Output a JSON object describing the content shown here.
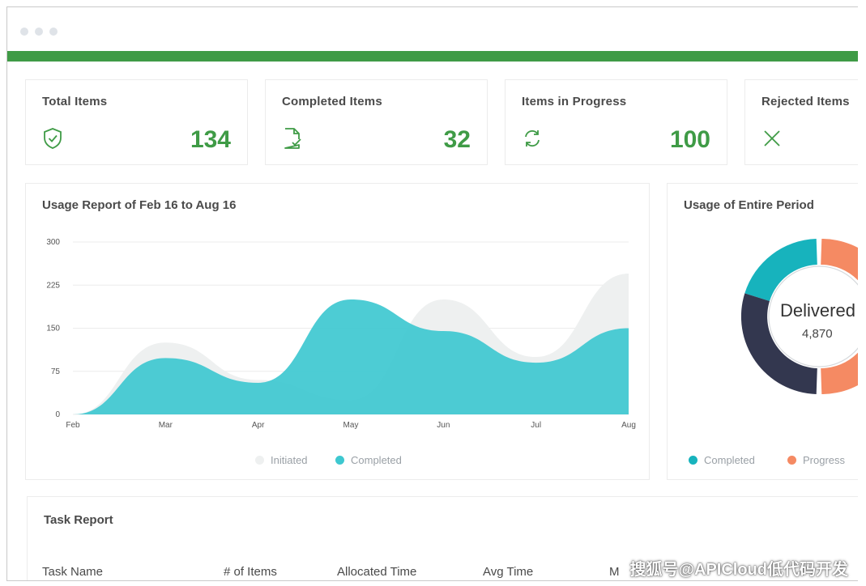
{
  "stats": [
    {
      "label": "Total Items",
      "value": "134",
      "icon": "shield-check-icon"
    },
    {
      "label": "Completed Items",
      "value": "32",
      "icon": "document-check-icon"
    },
    {
      "label": "Items in Progress",
      "value": "100",
      "icon": "refresh-icon"
    },
    {
      "label": "Rejected Items",
      "value": "",
      "icon": "close-icon"
    }
  ],
  "usage_report": {
    "title": "Usage Report of Feb 16 to Aug 16"
  },
  "usage_period": {
    "title": "Usage of Entire Period",
    "center_label": "Delivered",
    "center_value": "4,870"
  },
  "task_report": {
    "title": "Task Report",
    "columns": [
      "Task Name",
      "# of Items",
      "Allocated Time",
      "Avg Time",
      "M"
    ]
  },
  "watermark": "搜狐号@APICloud低代码开发",
  "colors": {
    "accent": "#3f9b46",
    "completed": "#3ec8d0",
    "initiated": "#eef0f0",
    "progress": "#f58a63",
    "dark": "#33374f",
    "teal": "#17b3bd"
  },
  "chart_data": [
    {
      "type": "area",
      "title": "Usage Report of Feb 16 to Aug 16",
      "categories": [
        "Feb",
        "Mar",
        "Apr",
        "May",
        "Jun",
        "Jul",
        "Aug"
      ],
      "series": [
        {
          "name": "Initiated",
          "values": [
            0,
            125,
            60,
            25,
            200,
            100,
            245
          ]
        },
        {
          "name": "Completed",
          "values": [
            0,
            98,
            55,
            200,
            145,
            90,
            150
          ]
        }
      ],
      "ylim": [
        0,
        300
      ],
      "yticks": [
        0,
        75,
        150,
        225,
        300
      ],
      "grid": true,
      "legend": "bottom"
    },
    {
      "type": "pie",
      "title": "Usage of Entire Period",
      "categories": [
        "Completed",
        "Progress"
      ],
      "legend": "bottom"
    }
  ]
}
